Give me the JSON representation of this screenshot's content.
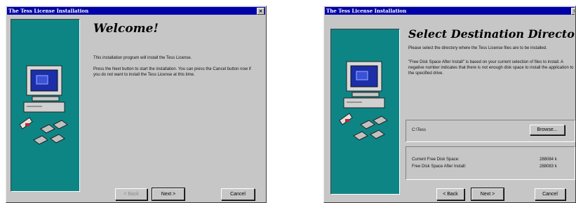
{
  "welcome_dialog": {
    "title": "The Tess License Installation",
    "heading": "Welcome!",
    "intro": "This installation program will install the Tess License.",
    "instructions": "Press the Next button to start the installation. You can press the Cancel button now if you do not want to install the Tess License at this time.",
    "buttons": {
      "back": "< Back",
      "next": "Next >",
      "cancel": "Cancel"
    }
  },
  "destination_dialog": {
    "title": "The Tess License Installation",
    "heading": "Select Destination Directory",
    "intro": "Please select the directory where the Tess License files are to be installed.",
    "note": "\"Free Disk Space After Install\" is based on your current selection of files to install. A negative number indicates that there is not enough disk space to install the application to the specified drive.",
    "path": "C:\\Tess",
    "browse_label": "Browse...",
    "disk_space": {
      "current_label": "Current Free Disk Space:",
      "current_value": "288084 k",
      "after_label": "Free Disk Space After Install:",
      "after_value": "288083 k"
    },
    "buttons": {
      "back": "< Back",
      "next": "Next >",
      "cancel": "Cancel"
    }
  },
  "colors": {
    "titlebar": "#0000a8",
    "dialog_face": "#c6c6c6",
    "art_panel": "#0e8585"
  }
}
